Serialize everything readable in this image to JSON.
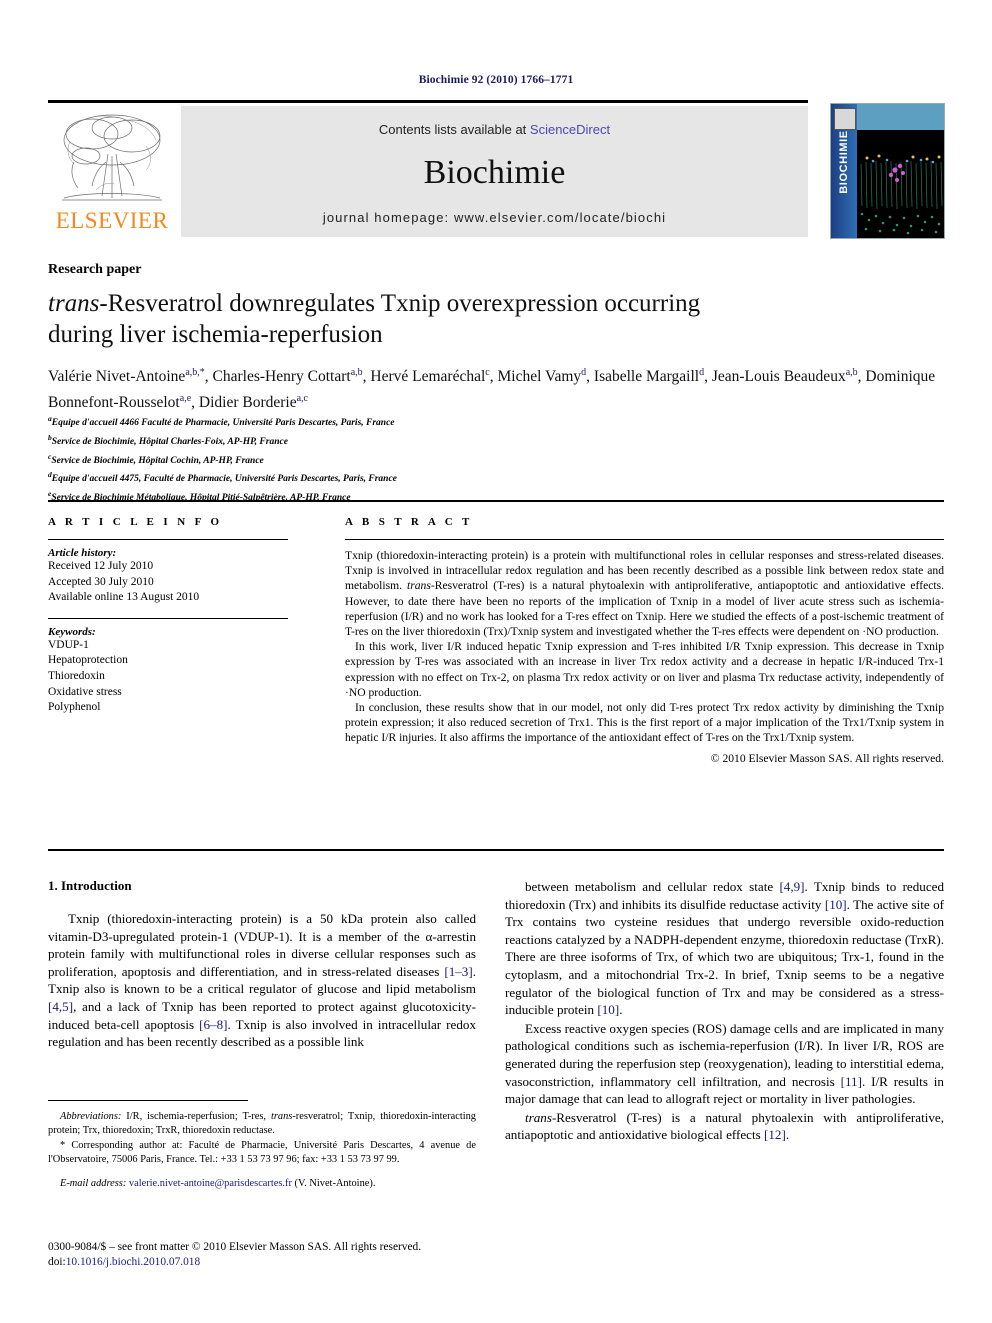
{
  "running_head": "Biochimie 92 (2010) 1766–1771",
  "masthead": {
    "contents_prefix": "Contents lists available at ",
    "sciencedirect": "ScienceDirect",
    "journal_name": "Biochimie",
    "homepage": "journal homepage: www.elsevier.com/locate/biochi",
    "publisher_word": "ELSEVIER",
    "cover_spine_text": "BIOCHIMIE",
    "accent_orange": "#f08a1c",
    "link_blue": "#4a4ab0",
    "band_grey": "#e6e6e6"
  },
  "article": {
    "type_label": "Research paper",
    "title_line1_italic": "trans",
    "title_line1_rest": "-Resveratrol downregulates Txnip overexpression occurring",
    "title_line2": "during liver ischemia-reperfusion",
    "authors": [
      {
        "name": "Valérie Nivet-Antoine",
        "sup": "a,b,*"
      },
      {
        "name": "Charles-Henry Cottart",
        "sup": "a,b"
      },
      {
        "name": "Hervé Lemaréchal",
        "sup": "c"
      },
      {
        "name": "Michel Vamy",
        "sup": "d"
      },
      {
        "name": "Isabelle Margaill",
        "sup": "d"
      },
      {
        "name": "Jean-Louis Beaudeux",
        "sup": "a,b"
      },
      {
        "name": "Dominique Bonnefont-Rousselot",
        "sup": "a,e"
      },
      {
        "name": "Didier Borderie",
        "sup": "a,c"
      }
    ],
    "affiliations": [
      {
        "mark": "a",
        "text": "Equipe d'accueil 4466 Faculté de Pharmacie, Université Paris Descartes, Paris, France"
      },
      {
        "mark": "b",
        "text": "Service de Biochimie, Hôpital Charles-Foix, AP-HP, France"
      },
      {
        "mark": "c",
        "text": "Service de Biochimie, Hôpital Cochin, AP-HP, France"
      },
      {
        "mark": "d",
        "text": "Equipe d'accueil 4475, Faculté de Pharmacie, Université Paris Descartes, Paris, France"
      },
      {
        "mark": "e",
        "text": "Service de Biochimie Métabolique, Hôpital Pitié-Salpêtrière, AP-HP, France"
      }
    ]
  },
  "article_info": {
    "heading": "A R T I C L E   I N F O",
    "history_label": "Article history:",
    "history": [
      "Received 12 July 2010",
      "Accepted 30 July 2010",
      "Available online 13 August 2010"
    ],
    "keywords_label": "Keywords:",
    "keywords": [
      "VDUP-1",
      "Hepatoprotection",
      "Thioredoxin",
      "Oxidative stress",
      "Polyphenol"
    ]
  },
  "abstract": {
    "heading": "A B S T R A C T",
    "paragraphs": [
      "Txnip (thioredoxin-interacting protein) is a protein with multifunctional roles in cellular responses and stress-related diseases. Txnip is involved in intracellular redox regulation and has been recently described as a possible link between redox state and metabolism. trans-Resveratrol (T-res) is a natural phytoalexin with antiproliferative, antiapoptotic and antioxidative effects. However, to date there have been no reports of the implication of Txnip in a model of liver acute stress such as ischemia-reperfusion (I/R) and no work has looked for a T-res effect on Txnip. Here we studied the effects of a post-ischemic treatment of T-res on the liver thioredoxin (Trx)/Txnip system and investigated whether the T-res effects were dependent on ·NO production.",
      "In this work, liver I/R induced hepatic Txnip expression and T-res inhibited I/R Txnip expression. This decrease in Txnip expression by T-res was associated with an increase in liver Trx redox activity and a decrease in hepatic I/R-induced Trx-1 expression with no effect on Trx-2, on plasma Trx redox activity or on liver and plasma Trx reductase activity, independently of ·NO production.",
      "In conclusion, these results show that in our model, not only did T-res protect Trx redox activity by diminishing the Txnip protein expression; it also reduced secretion of Trx1. This is the first report of a major implication of the Trx1/Txnip system in hepatic I/R injuries. It also affirms the importance of the antioxidant effect of T-res on the Trx1/Txnip system."
    ],
    "copyright": "© 2010 Elsevier Masson SAS. All rights reserved."
  },
  "introduction": {
    "heading": "1.  Introduction",
    "left_paragraph": "Txnip (thioredoxin-interacting protein) is a 50 kDa protein also called vitamin-D3-upregulated protein-1 (VDUP-1). It is a member of the α-arrestin protein family with multifunctional roles in diverse cellular responses such as proliferation, apoptosis and differentiation, and in stress-related diseases [1–3]. Txnip also is known to be a critical regulator of glucose and lipid metabolism [4,5], and a lack of Txnip has been reported to protect against glucotoxicity-induced beta-cell apoptosis [6–8]. Txnip is also involved in intracellular redox regulation and has been recently described as a possible link",
    "right_paragraph_1": "between metabolism and cellular redox state [4,9]. Txnip binds to reduced thioredoxin (Trx) and inhibits its disulfide reductase activity [10]. The active site of Trx contains two cysteine residues that undergo reversible oxido-reduction reactions catalyzed by a NADPH-dependent enzyme, thioredoxin reductase (TrxR). There are three isoforms of Trx, of which two are ubiquitous; Trx-1, found in the cytoplasm, and a mitochondrial Trx-2. In brief, Txnip seems to be a negative regulator of the biological function of Trx and may be considered as a stress-inducible protein [10].",
    "right_paragraph_2": "Excess reactive oxygen species (ROS) damage cells and are implicated in many pathological conditions such as ischemia-reperfusion (I/R). In liver I/R, ROS are generated during the reperfusion step (reoxygenation), leading to interstitial edema, vasoconstriction, inflammatory cell infiltration, and necrosis [11]. I/R results in major damage that can lead to allograft reject or mortality in liver pathologies.",
    "right_paragraph_3_italic": "trans",
    "right_paragraph_3": "-Resveratrol (T-res) is a natural phytoalexin with antiproliferative, antiapoptotic and antioxidative biological effects [12]."
  },
  "footnotes": {
    "abbreviations_label": "Abbreviations:",
    "abbreviations_text": " I/R, ischemia-reperfusion; T-res, trans-resveratrol; Txnip, thioredoxin-interacting protein; Trx, thioredoxin; TrxR, thioredoxin reductase.",
    "corresponding": "* Corresponding author at: Faculté de Pharmacie, Université Paris Descartes, 4 avenue de l'Observatoire, 75006 Paris, France. Tel.: +33 1 53 73 97 96; fax: +33 1 53 73 97 99.",
    "email_label": "E-mail address:",
    "email": "valerie.nivet-antoine@parisdescartes.fr",
    "email_suffix": " (V. Nivet-Antoine).",
    "issn_line": "0300-9084/$ – see front matter © 2010 Elsevier Masson SAS. All rights reserved.",
    "doi_label": "doi:",
    "doi_value": "10.1016/j.biochi.2010.07.018"
  }
}
